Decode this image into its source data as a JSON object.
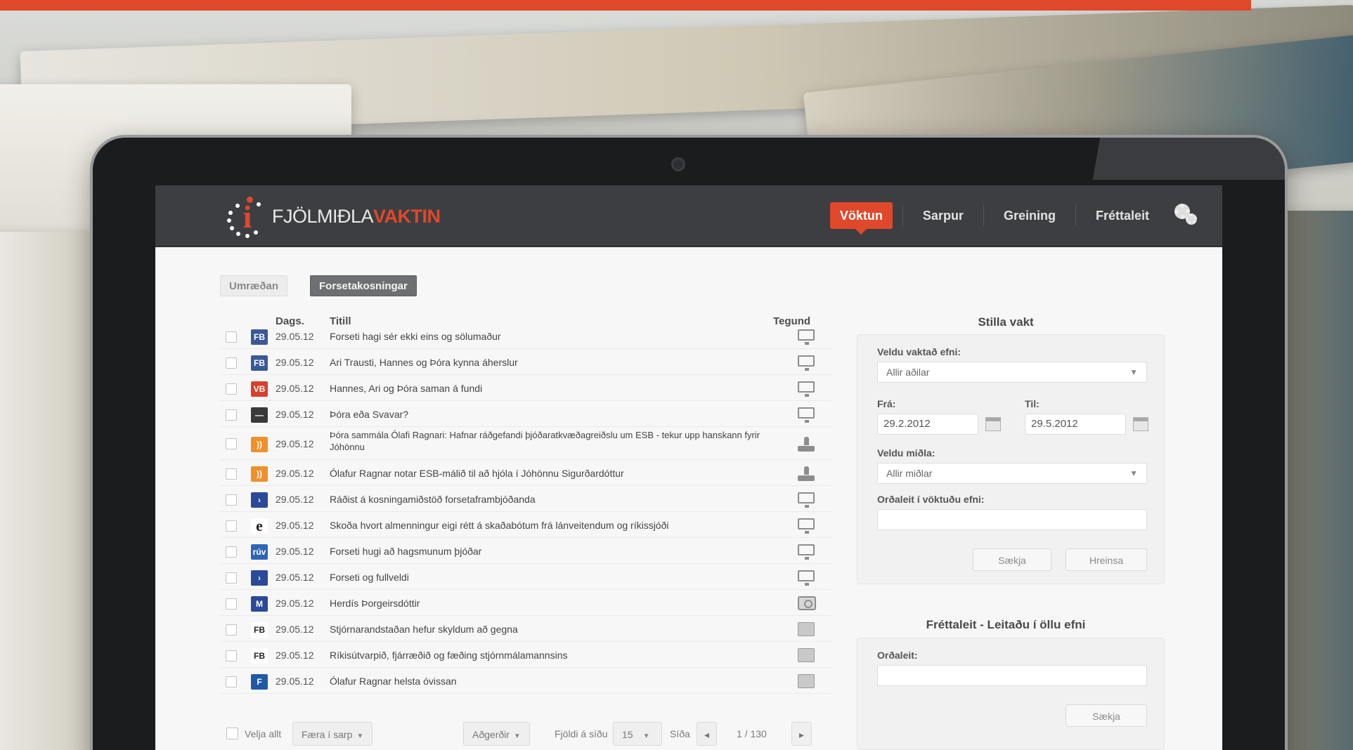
{
  "brand": {
    "logo_prefix": "FJÖLMIÐLA",
    "logo_accent": "VAKTIN",
    "accent_color": "#e0482b",
    "header_bg": "#3d3e41"
  },
  "nav": {
    "items": [
      {
        "label": "Vöktun",
        "active": true
      },
      {
        "label": "Sarpur",
        "active": false
      },
      {
        "label": "Greining",
        "active": false
      },
      {
        "label": "Fréttaleit",
        "active": false
      }
    ],
    "settings_icon": "gears-icon"
  },
  "tabs": [
    {
      "label": "Umræðan",
      "active": false
    },
    {
      "label": "Forsetakosningar",
      "active": true
    }
  ],
  "table": {
    "headers": {
      "date": "Dags.",
      "title": "Titill",
      "kind": "Tegund"
    },
    "rows": [
      {
        "source_icon": "fb",
        "source_color": "#3b5998",
        "source_glyph": "FB",
        "date": "29.05.12",
        "title": "Forseti hagi sér ekki eins og sölumaður",
        "kind": "tv"
      },
      {
        "source_icon": "fb",
        "source_color": "#3b5998",
        "source_glyph": "FB",
        "date": "29.05.12",
        "title": "Ari Trausti, Hannes og Þóra kynna áherslur",
        "kind": "tv"
      },
      {
        "source_icon": "vb",
        "source_color": "#d9402b",
        "source_glyph": "VB",
        "date": "29.05.12",
        "title": "Hannes, Ari og Þóra saman á fundi",
        "kind": "tv"
      },
      {
        "source_icon": "doc",
        "source_color": "#3a3a3a",
        "source_glyph": "—",
        "date": "29.05.12",
        "title": "Þóra eða Svavar?",
        "kind": "tv"
      },
      {
        "source_icon": "rss",
        "source_color": "#f0902a",
        "source_glyph": "))",
        "date": "29.05.12",
        "title": "Þóra sammála Ólafi Ragnari: Hafnar ráðgefandi þjóðaratkvæðagreiðslu um ESB - tekur upp hanskann fyrir Jóhönnu",
        "kind": "radio"
      },
      {
        "source_icon": "rss",
        "source_color": "#f0902a",
        "source_glyph": "))",
        "date": "29.05.12",
        "title": "Ólafur Ragnar notar ESB-málið til að hjóla í Jóhönnu Sigurðardóttur",
        "kind": "radio"
      },
      {
        "source_icon": "play",
        "source_color": "#2a4a9a",
        "source_glyph": "›",
        "date": "29.05.12",
        "title": "Ráðist á kosningamiðstöð forsetaframbjóðanda",
        "kind": "tv"
      },
      {
        "source_icon": "e",
        "source_color": "#ffffff",
        "source_glyph": "e",
        "date": "29.05.12",
        "title": "Skoða hvort almenningur eigi rétt á skaðabótum frá lánveitendum og ríkissjóði",
        "kind": "tv"
      },
      {
        "source_icon": "ruv",
        "source_color": "#2f66b3",
        "source_glyph": "rúv",
        "date": "29.05.12",
        "title": "Forseti hugi að hagsmunum þjóðar",
        "kind": "tv"
      },
      {
        "source_icon": "play",
        "source_color": "#2a4a9a",
        "source_glyph": "›",
        "date": "29.05.12",
        "title": "Forseti og fullveldi",
        "kind": "tv"
      },
      {
        "source_icon": "mbl",
        "source_color": "#2a4a9a",
        "source_glyph": "M",
        "date": "29.05.12",
        "title": "Herdís Þorgeirsdóttir",
        "kind": "camera"
      },
      {
        "source_icon": "fbl",
        "source_color": "#ffffff",
        "source_glyph": "FB",
        "date": "29.05.12",
        "title": "Stjórnarandstaðan hefur skyldum að gegna",
        "kind": "print"
      },
      {
        "source_icon": "fbl",
        "source_color": "#ffffff",
        "source_glyph": "FB",
        "date": "29.05.12",
        "title": "Ríkisútvarpið, fjárræðið og fæðing stjórnmálamannsins",
        "kind": "print"
      },
      {
        "source_icon": "f",
        "source_color": "#1f5aa6",
        "source_glyph": "F",
        "date": "29.05.12",
        "title": "Ólafur Ragnar helsta óvissan",
        "kind": "print"
      }
    ]
  },
  "footer": {
    "select_all": "Velja allt",
    "move_to_archive": "Færa í sarp",
    "actions": "Aðgerðir",
    "per_page_label": "Fjöldi á síðu",
    "per_page_value": "15",
    "page_label": "Síða",
    "page_value": "1 / 130"
  },
  "watch_panel": {
    "title": "Stilla vakt",
    "content_label": "Veldu vaktað efni:",
    "content_value": "Allir aðilar",
    "from_label": "Frá:",
    "from_value": "29.2.2012",
    "to_label": "Til:",
    "to_value": "29.5.2012",
    "media_label": "Veldu miðla:",
    "media_value": "Allir miðlar",
    "keyword_label": "Orðaleit í vöktuðu efni:",
    "keyword_value": "",
    "fetch_button": "Sækja",
    "clear_button": "Hreinsa"
  },
  "search_panel": {
    "title": "Fréttaleit - Leitaðu í öllu efni",
    "keyword_label": "Orðaleit:",
    "keyword_value": "",
    "fetch_button": "Sækja"
  }
}
